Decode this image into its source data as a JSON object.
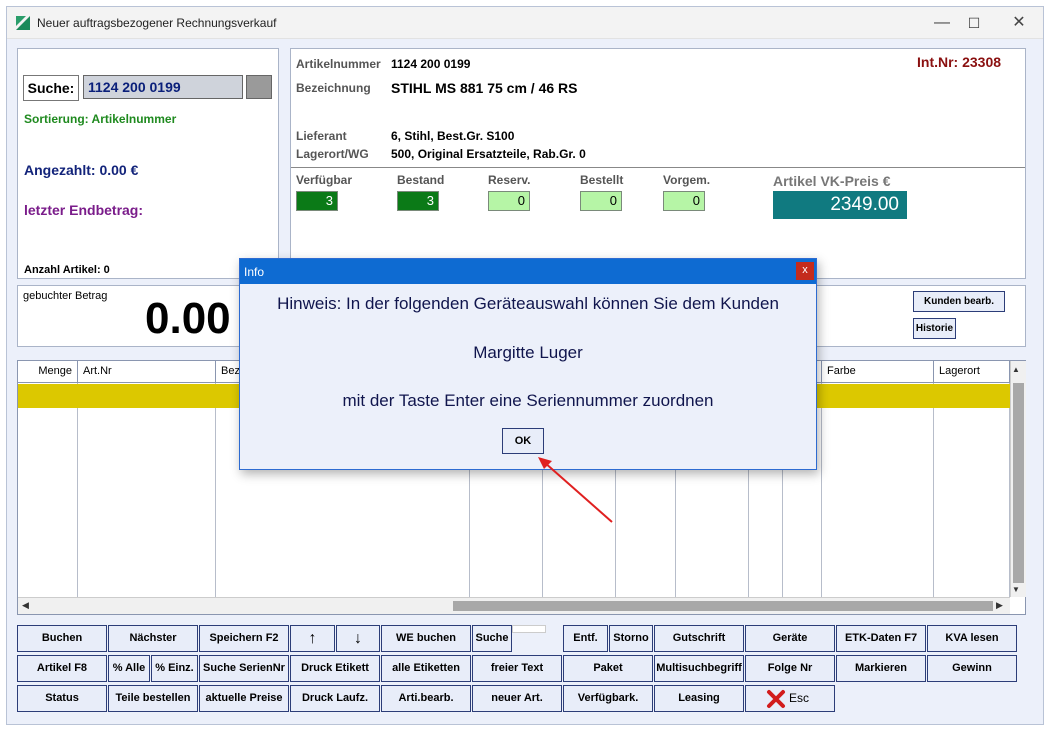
{
  "window": {
    "title": "Neuer auftragsbezogener Rechnungsverkauf",
    "min": "—",
    "max": "☐",
    "close": "✕"
  },
  "left": {
    "search_label": "Suche:",
    "search_value": "1124 200 0199",
    "sort_text": "Sortierung: Artikelnummer",
    "angezahlt": "Angezahlt: 0.00 €",
    "letzter": "letzter Endbetrag:",
    "anzahl": "Anzahl Artikel: 0"
  },
  "article": {
    "artnr_label": "Artikelnummer",
    "artnr_value": "1124 200 0199",
    "bez_label": "Bezeichnung",
    "bez_value": "STIHL MS 881 75 cm / 46 RS",
    "intnr": "Int.Nr: 23308",
    "lieferant_label": "Lieferant",
    "lieferant_value": "6, Stihl, Best.Gr. S100",
    "lagerort_label": "Lagerort/WG",
    "lagerort_value": "500, Original Ersatzteile, Rab.Gr. 0",
    "stock": [
      {
        "label": "Verfügbar",
        "value": "3"
      },
      {
        "label": "Bestand",
        "value": "3"
      },
      {
        "label": "Reserv.",
        "value": "0"
      },
      {
        "label": "Bestellt",
        "value": "0"
      },
      {
        "label": "Vorgem.",
        "value": "0"
      }
    ],
    "price_label": "Artikel VK-Preis €",
    "price_value": "2349.00"
  },
  "booked": {
    "label": "gebuchter Betrag",
    "value": "0.00",
    "kunden": "Kunden bearb.",
    "historie": "Historie"
  },
  "grid": {
    "headers": [
      "Menge",
      "Art.Nr",
      "Bez",
      "Farbe",
      "Lagerort"
    ]
  },
  "toolbar": {
    "row1": [
      "Buchen",
      "Nächster",
      "Speichern F2",
      "↑",
      "↓",
      "WE buchen",
      "Suche",
      "Entf.",
      "Storno",
      "Gutschrift",
      "Geräte",
      "ETK-Daten F7",
      "KVA lesen"
    ],
    "row2": [
      "Artikel F8",
      "% Alle",
      "% Einz.",
      "Suche SerienNr",
      "Druck Etikett",
      "alle Etiketten",
      "freier Text",
      "Paket",
      "Multisuchbegriff",
      "Folge Nr",
      "Markieren",
      "Gewinn"
    ],
    "row3": [
      "Status",
      "Teile bestellen",
      "aktuelle Preise",
      "Druck Laufz.",
      "Arti.bearb.",
      "neuer Art.",
      "Verfügbark.",
      "Leasing",
      "Esc"
    ]
  },
  "dialog": {
    "title": "Info",
    "close": "x",
    "line1": "Hinweis: In der folgenden Geräteauswahl können Sie dem Kunden",
    "line2": "Margitte Luger",
    "line3": "mit der Taste Enter eine Seriennummer zuordnen",
    "ok": "OK"
  },
  "colors": {
    "accent": "#0e6bd2",
    "dark_green": "#0a7a1a",
    "light_green": "#b6f5a6",
    "teal": "#107a80",
    "yellow_row": "#dcc800"
  }
}
